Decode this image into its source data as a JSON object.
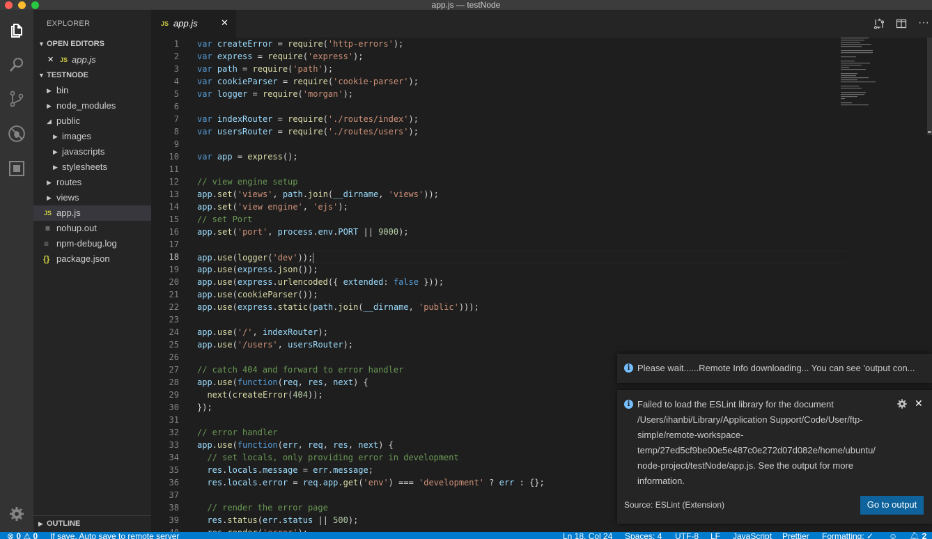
{
  "window": {
    "title": "app.js — testNode"
  },
  "sidebar": {
    "title": "EXPLORER",
    "open_editors": {
      "label": "OPEN EDITORS",
      "items": [
        {
          "icon": "JS",
          "name": "app.js"
        }
      ]
    },
    "project": {
      "label": "TESTNODE",
      "items": [
        {
          "name": "bin"
        },
        {
          "name": "node_modules"
        },
        {
          "name": "public"
        },
        {
          "name": "images"
        },
        {
          "name": "javascripts"
        },
        {
          "name": "stylesheets"
        },
        {
          "name": "routes"
        },
        {
          "name": "views"
        },
        {
          "name": "app.js",
          "icon": "JS"
        },
        {
          "name": "nohup.out",
          "icon": "≡"
        },
        {
          "name": "npm-debug.log",
          "icon": "≡"
        },
        {
          "name": "package.json",
          "icon": "{}"
        }
      ]
    },
    "outline": {
      "label": "OUTLINE"
    }
  },
  "tabs": [
    {
      "icon": "JS",
      "name": "app.js",
      "close": "✕"
    }
  ],
  "editor": {
    "current_line": 18,
    "line_numbers": [
      "1",
      "2",
      "3",
      "4",
      "5",
      "6",
      "7",
      "8",
      "9",
      "10",
      "11",
      "12",
      "13",
      "14",
      "15",
      "16",
      "17",
      "18",
      "19",
      "20",
      "21",
      "22",
      "23",
      "24",
      "25",
      "26",
      "27",
      "28",
      "29",
      "30",
      "31",
      "32",
      "33",
      "34",
      "35",
      "36",
      "37",
      "38",
      "39",
      "40"
    ]
  },
  "notifications": [
    {
      "icon": "i",
      "message": "Please wait......Remote Info downloading... You can see 'output con..."
    },
    {
      "icon": "i",
      "message_lines": [
        "Failed to load the ESLint library for the document",
        "/Users/ihanbi/Library/Application Support/Code/User/ftp-",
        "simple/remote-workspace-",
        "temp/27ed5cf9be00e5e487c0e272d07d082e/home/ubuntu/",
        "node-project/testNode/app.js. See the output for more",
        "information."
      ],
      "source": "Source: ESLint (Extension)",
      "button": "Go to output"
    }
  ],
  "statusbar": {
    "errors": "0",
    "warnings": "0",
    "message": "If save, Auto save to remote server",
    "position": "Ln 18, Col 24",
    "indent": "Spaces: 4",
    "encoding": "UTF-8",
    "eol": "LF",
    "language": "JavaScript",
    "prettier": "Prettier",
    "formatting": "Formatting: ✓",
    "notifications_count": "2"
  },
  "colors": {
    "accent": "#007acc",
    "button": "#0e639c",
    "info": "#75beff",
    "js_icon": "#cbcb41"
  }
}
